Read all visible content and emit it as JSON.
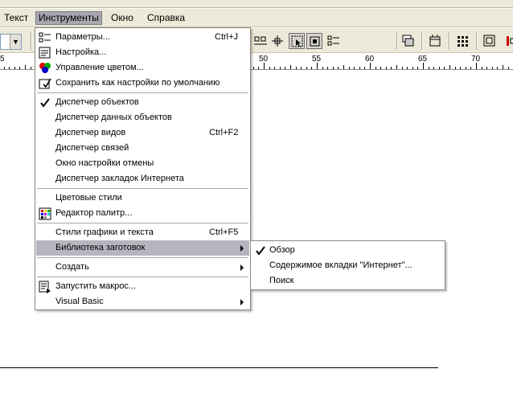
{
  "menubar": {
    "items": [
      {
        "label": "Текст"
      },
      {
        "label": "Инструменты"
      },
      {
        "label": "Окно"
      },
      {
        "label": "Справка"
      }
    ]
  },
  "ruler": {
    "labels": [
      "5",
      "50",
      "55",
      "60",
      "65",
      "70"
    ]
  },
  "tools_menu": {
    "items": [
      {
        "label": "Параметры...",
        "shortcut": "Ctrl+J"
      },
      {
        "label": "Настройка..."
      },
      {
        "label": "Управление цветом..."
      },
      {
        "label": "Сохранить как настройки по умолчанию"
      },
      {
        "label": "Диспетчер объектов",
        "checked": true
      },
      {
        "label": "Диспетчер данных объектов"
      },
      {
        "label": "Диспетчер видов",
        "shortcut": "Ctrl+F2"
      },
      {
        "label": "Диспетчер связей"
      },
      {
        "label": "Окно настройки отмены"
      },
      {
        "label": "Диспетчер закладок Интернета"
      },
      {
        "label": "Цветовые стили"
      },
      {
        "label": "Редактор палитр..."
      },
      {
        "label": "Стили графики и текста",
        "shortcut": "Ctrl+F5"
      },
      {
        "label": "Библиотека заготовок",
        "highlighted": true
      },
      {
        "label": "Создать"
      },
      {
        "label": "Запустить макрос..."
      },
      {
        "label": "Visual Basic"
      }
    ]
  },
  "library_submenu": {
    "items": [
      {
        "label": "Обзор",
        "checked": true
      },
      {
        "label": "Содержимое вкладки \"Интернет\"..."
      },
      {
        "label": "Поиск"
      }
    ]
  },
  "colors": {
    "chrome": "#ece9d8",
    "highlight": "#b6b4be",
    "menu_active": "#a8a6b0"
  }
}
